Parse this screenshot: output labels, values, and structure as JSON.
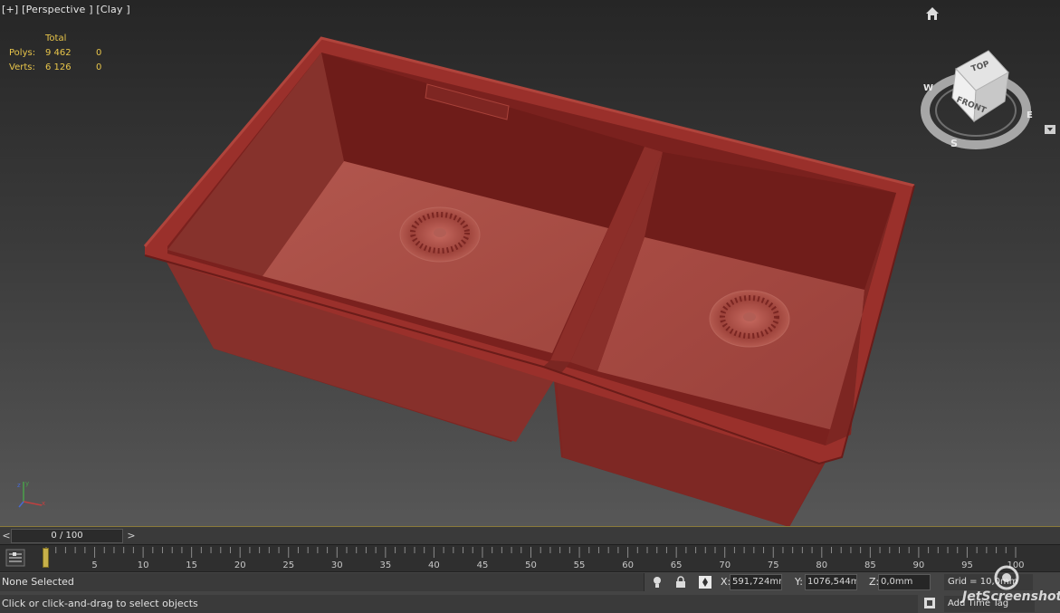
{
  "viewport": {
    "label": "[+] [Perspective ] [Clay ]",
    "stats": {
      "header": "Total",
      "rows": [
        {
          "label": "Polys:",
          "total": "9 462",
          "selected": "0"
        },
        {
          "label": "Verts:",
          "total": "6 126",
          "selected": "0"
        }
      ]
    },
    "viewcube": {
      "top": "TOP",
      "front": "FRONT",
      "west": "W",
      "south": "S",
      "east": "E"
    },
    "sink_color": "#8e2a26"
  },
  "timebar": {
    "prev": "<",
    "next": ">",
    "slider": "0 / 100"
  },
  "trackbar": {
    "ticks": [
      "0",
      "5",
      "10",
      "15",
      "20",
      "25",
      "30",
      "35",
      "40",
      "45",
      "50",
      "55",
      "60",
      "65",
      "70",
      "75",
      "80",
      "85",
      "90",
      "95",
      "100"
    ]
  },
  "statusbar": {
    "selection": "None Selected",
    "prompt": "Click or click-and-drag to select objects",
    "x_label": "X:",
    "x_value": "591,724mm",
    "y_label": "Y:",
    "y_value": "1076,544mm",
    "z_label": "Z:",
    "z_value": "0,0mm",
    "grid": "Grid = 10,0mm",
    "add_time_tag": "Add Time Tag"
  },
  "watermark": "JetScreenshot"
}
